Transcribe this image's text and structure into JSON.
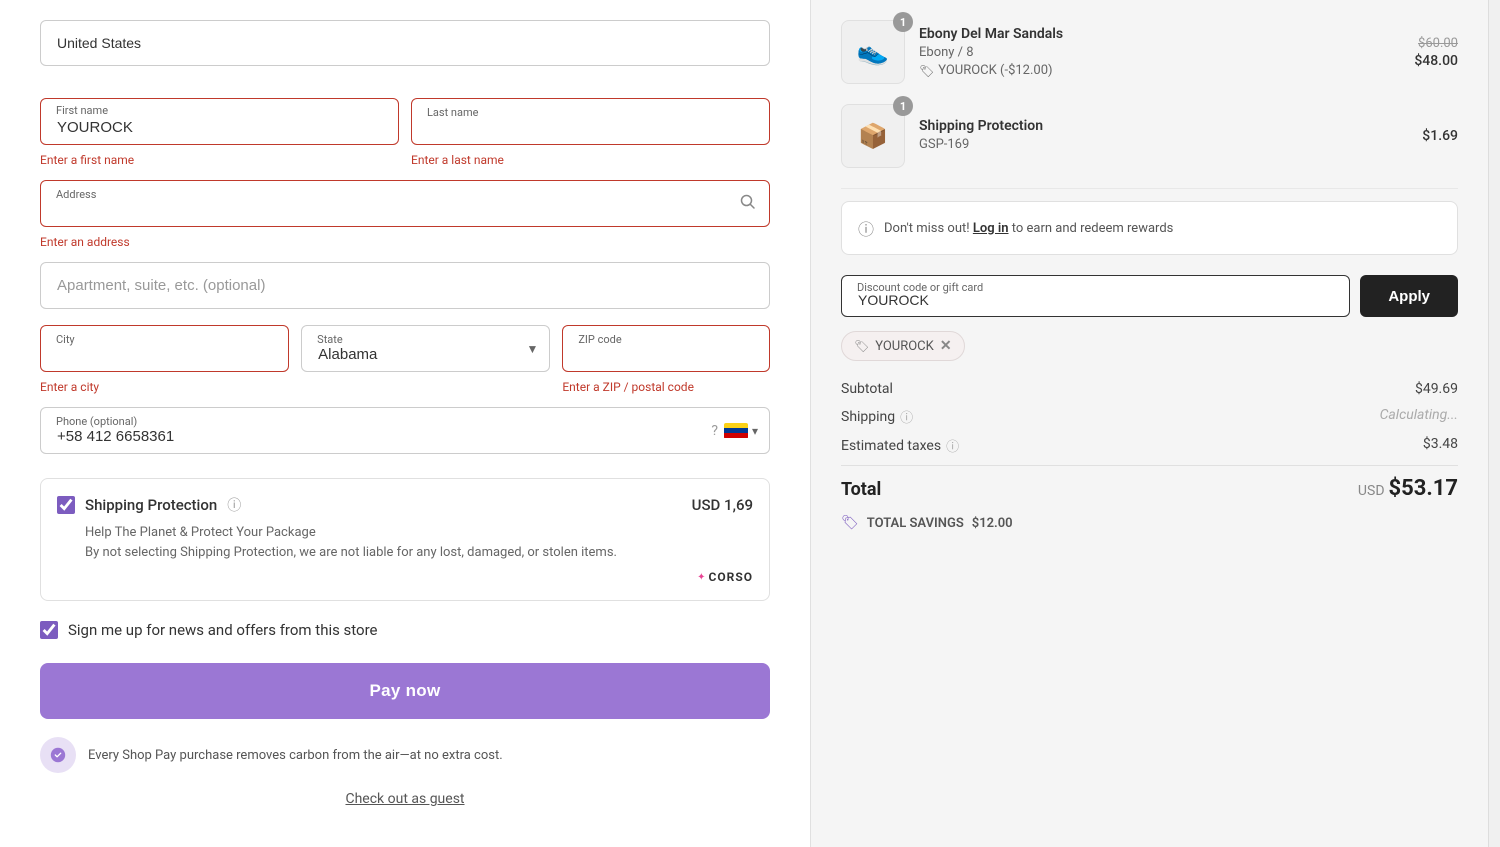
{
  "left": {
    "country_placeholder": "United States",
    "first_name_label": "First name",
    "first_name_value": "YOUROCK",
    "last_name_label": "Last name",
    "last_name_placeholder": "Last name",
    "first_name_error": "Enter a first name",
    "last_name_error": "Enter a last name",
    "address_label": "Address",
    "address_error": "Enter an address",
    "apt_placeholder": "Apartment, suite, etc. (optional)",
    "city_label": "City",
    "city_error": "Enter a city",
    "state_label": "State",
    "state_value": "Alabama",
    "zip_label": "ZIP code",
    "zip_error": "Enter a ZIP / postal code",
    "phone_label": "Phone (optional)",
    "phone_value": "+58 412 6658361",
    "shipping_protection_label": "Shipping Protection",
    "shipping_protection_price": "USD 1,69",
    "sp_desc1": "Help The Planet & Protect Your Package",
    "sp_desc2": "By not selecting Shipping Protection, we are not liable for any lost, damaged, or stolen items.",
    "newsletter_label": "Sign me up for news and offers from this store",
    "pay_now_label": "Pay now",
    "shop_pay_notice": "Every Shop Pay purchase removes carbon from the air—at no extra cost.",
    "guest_checkout_label": "Check out as guest"
  },
  "right": {
    "item1": {
      "name": "Ebony Del Mar Sandals",
      "variant": "Ebony / 8",
      "discount_code": "YOUROCK (-$12.00)",
      "original_price": "$60.00",
      "final_price": "$48.00",
      "quantity": "1"
    },
    "item2": {
      "name": "Shipping Protection",
      "variant": "GSP-169",
      "price": "$1.69",
      "quantity": "1"
    },
    "rewards_text_before": "Don't miss out!",
    "rewards_link": "Log in",
    "rewards_text_after": "to earn and redeem rewards",
    "discount_label": "Discount code or gift card",
    "discount_value": "YOUROCK",
    "apply_label": "Apply",
    "coupon_code": "YOUROCK",
    "subtotal_label": "Subtotal",
    "subtotal_value": "$49.69",
    "shipping_label": "Shipping",
    "shipping_value": "Calculating...",
    "taxes_label": "Estimated taxes",
    "taxes_value": "$3.48",
    "total_label": "Total",
    "total_currency": "USD",
    "total_value": "$53.17",
    "savings_label": "TOTAL SAVINGS",
    "savings_value": "$12.00"
  }
}
